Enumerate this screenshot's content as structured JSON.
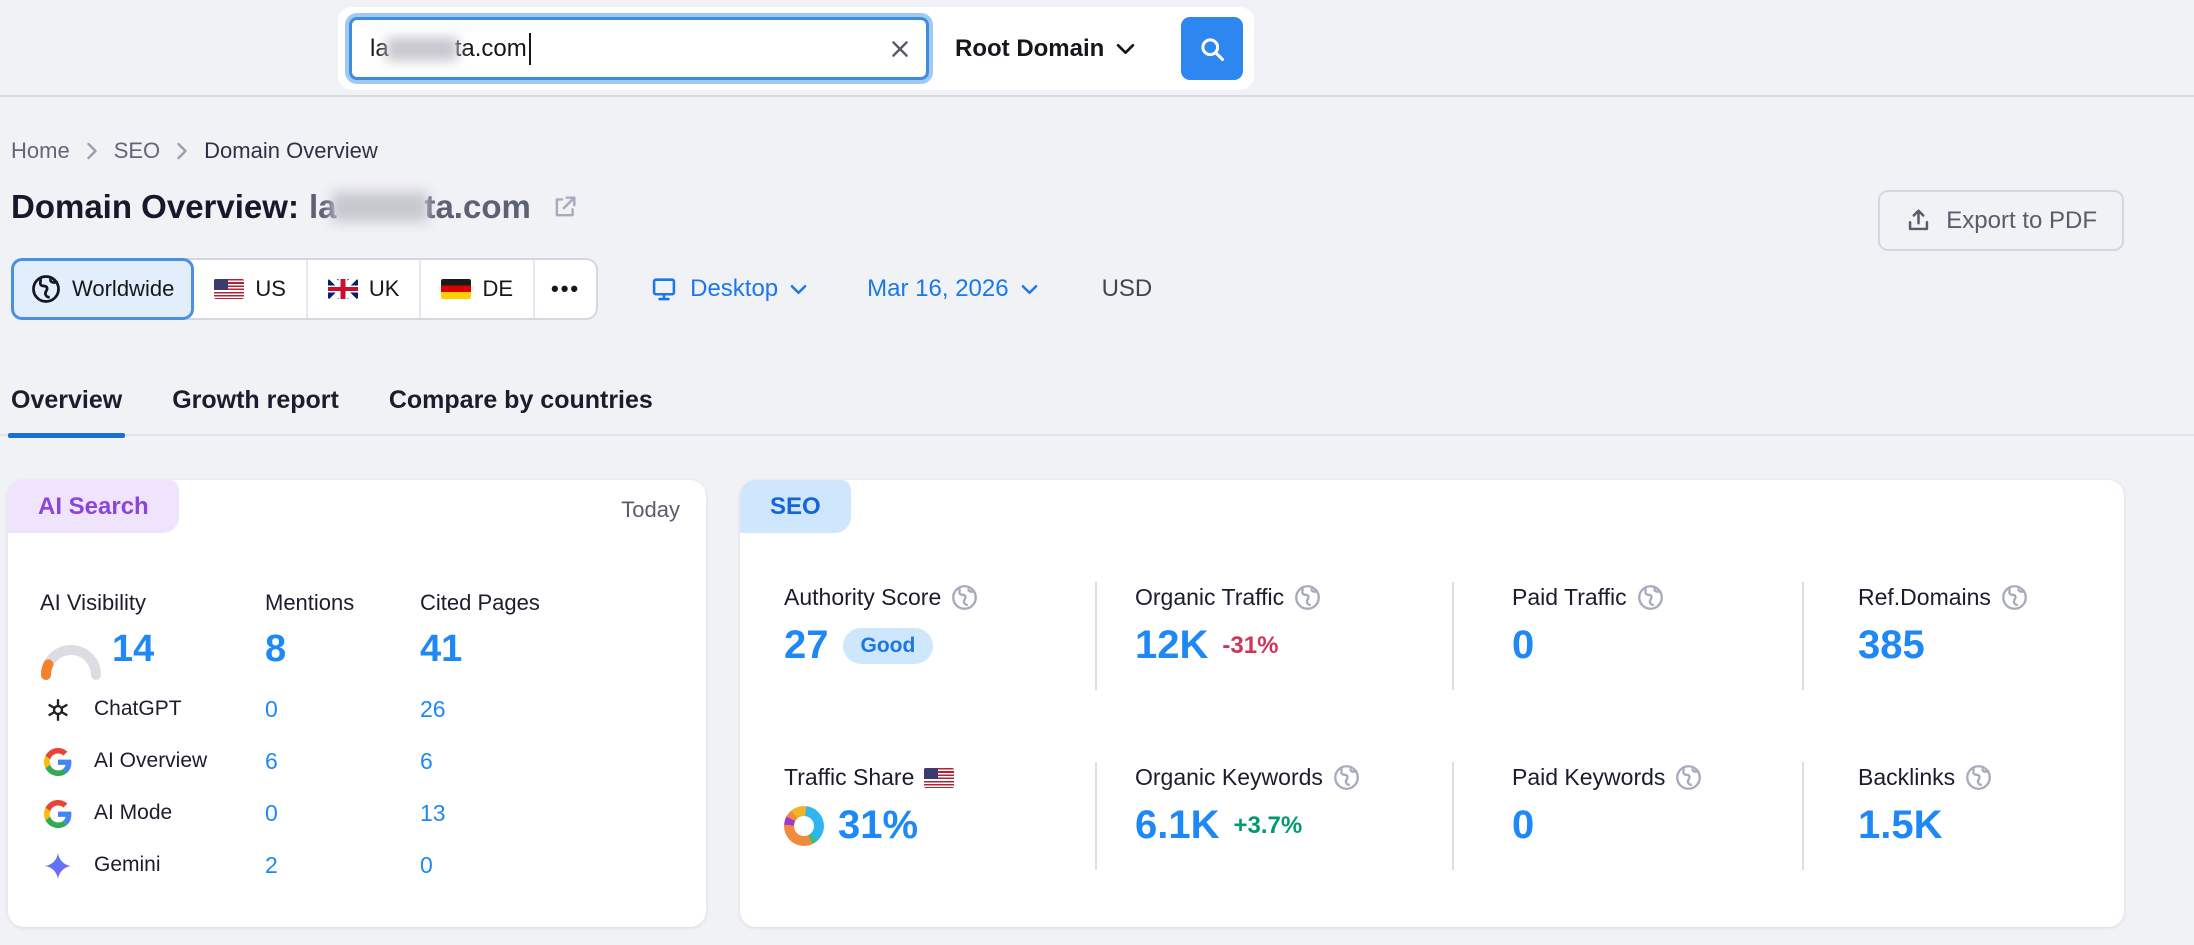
{
  "search_bar": {
    "query_prefix": "la",
    "query_suffix": "ta.com",
    "query_redacted": true,
    "scope_selected": "Root Domain"
  },
  "breadcrumb": {
    "items": [
      "Home",
      "SEO",
      "Domain Overview"
    ]
  },
  "header": {
    "title_prefix": "Domain Overview:",
    "domain_prefix": "la",
    "domain_suffix": "ta.com",
    "export_label": "Export to PDF"
  },
  "filters": {
    "regions": [
      {
        "label": "Worldwide",
        "selected": true
      },
      {
        "label": "US"
      },
      {
        "label": "UK"
      },
      {
        "label": "DE"
      },
      {
        "label": "•••"
      }
    ],
    "device": "Desktop",
    "date": "Mar 16, 2026",
    "currency": "USD"
  },
  "tabs": [
    {
      "label": "Overview",
      "active": true
    },
    {
      "label": "Growth report",
      "active": false
    },
    {
      "label": "Compare by countries",
      "active": false
    }
  ],
  "ai_search_card": {
    "badge": "AI Search",
    "period": "Today",
    "columns": {
      "c1": "AI Visibility",
      "c2": "Mentions",
      "c3": "Cited Pages"
    },
    "summary": {
      "ai_visibility": "14",
      "mentions": "8",
      "cited_pages": "41"
    },
    "gauge_percent": 14,
    "rows": [
      {
        "engine": "ChatGPT",
        "icon": "openai-icon",
        "mentions": "0",
        "cited_pages": "26"
      },
      {
        "engine": "AI Overview",
        "icon": "google-icon",
        "mentions": "6",
        "cited_pages": "6"
      },
      {
        "engine": "AI Mode",
        "icon": "google-icon",
        "mentions": "0",
        "cited_pages": "13"
      },
      {
        "engine": "Gemini",
        "icon": "gemini-icon",
        "mentions": "2",
        "cited_pages": "0"
      }
    ]
  },
  "seo_card": {
    "badge": "SEO",
    "metrics": [
      {
        "label": "Authority Score",
        "value": "27",
        "rating": "Good"
      },
      {
        "label": "Organic Traffic",
        "value": "12K",
        "delta": "-31%",
        "delta_dir": "down"
      },
      {
        "label": "Paid Traffic",
        "value": "0"
      },
      {
        "label": "Ref.Domains",
        "value": "385"
      },
      {
        "label": "Traffic Share",
        "value": "31%",
        "flag": "us"
      },
      {
        "label": "Organic Keywords",
        "value": "6.1K",
        "delta": "+3.7%",
        "delta_dir": "up"
      },
      {
        "label": "Paid Keywords",
        "value": "0"
      },
      {
        "label": "Backlinks",
        "value": "1.5K"
      }
    ]
  },
  "colors": {
    "page_background": "#f1f2f6",
    "metric_blue": "#1e88f7",
    "link_blue": "#1a78e8",
    "delta_down_red": "#cf3558",
    "delta_up_green": "#009a6e",
    "ai_badge_bg": "#f0e3fc",
    "ai_badge_text": "#8a46d9",
    "seo_badge_bg": "#cfe7fd",
    "seo_badge_text": "#1565d8",
    "gauge_orange": "#f5822b",
    "search_button_blue": "#2e86f0"
  }
}
